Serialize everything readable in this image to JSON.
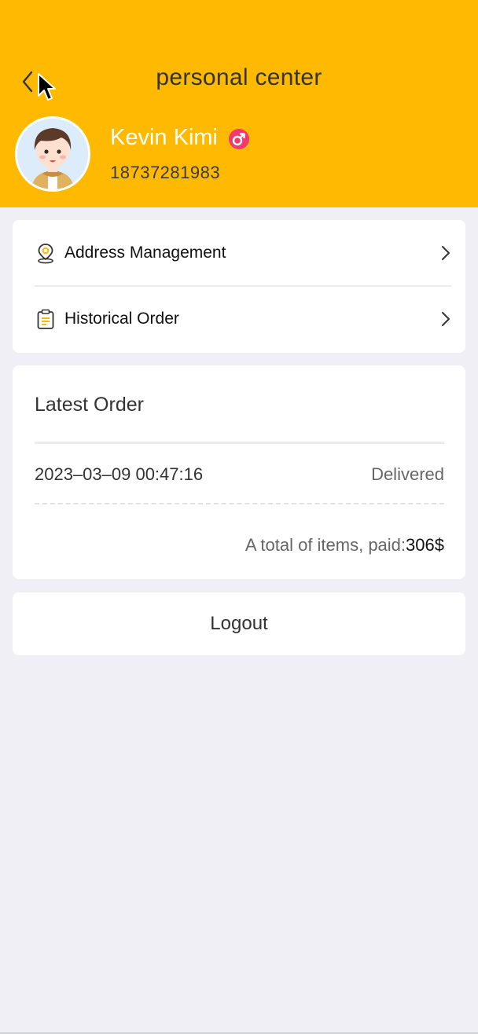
{
  "header": {
    "title": "personal center",
    "back_icon": "chevron-left-icon",
    "background": "#ffba00"
  },
  "profile": {
    "name": "Kevin Kimi",
    "gender_icon": "male-icon",
    "phone": "18737281983"
  },
  "menu": {
    "items": [
      {
        "label": "Address Management",
        "icon": "location-pin-icon"
      },
      {
        "label": "Historical Order",
        "icon": "clipboard-icon"
      }
    ]
  },
  "latest_order": {
    "title": "Latest Order",
    "time": "2023–03–09 00:47:16",
    "status": "Delivered",
    "total_label": "A total of items, paid:",
    "total_amount": "306$"
  },
  "logout": {
    "label": "Logout"
  },
  "colors": {
    "accent": "#ffba00",
    "gender": "#f2386f",
    "page_bg": "#efeff5"
  }
}
